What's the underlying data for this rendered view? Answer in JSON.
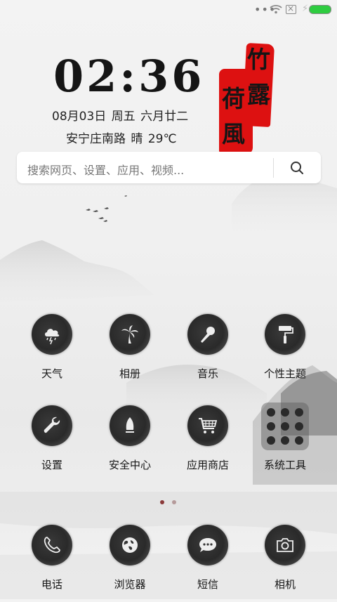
{
  "status_bar": {
    "dots": "•••",
    "colors": {
      "battery": "#2ecc40"
    }
  },
  "clock": {
    "time": "02:36",
    "date_line": "08月03日 周五 六月廿二",
    "weather_line": "安宁庄南路 晴 29℃"
  },
  "seal": {
    "chars": [
      "竹",
      "露",
      "荷",
      "風"
    ],
    "color": "#dd1111"
  },
  "search": {
    "placeholder": "搜索网页、设置、应用、视频..."
  },
  "apps": [
    {
      "label": "天气",
      "icon": "weather-icon"
    },
    {
      "label": "相册",
      "icon": "palm-tree-icon"
    },
    {
      "label": "音乐",
      "icon": "microphone-icon"
    },
    {
      "label": "个性主题",
      "icon": "paint-roller-icon"
    },
    {
      "label": "设置",
      "icon": "wrench-icon"
    },
    {
      "label": "安全中心",
      "icon": "shield-icon"
    },
    {
      "label": "应用商店",
      "icon": "cart-icon"
    },
    {
      "label": "系统工具",
      "icon": "folder-icon"
    }
  ],
  "dock": [
    {
      "label": "电话",
      "icon": "phone-icon"
    },
    {
      "label": "浏览器",
      "icon": "globe-icon"
    },
    {
      "label": "短信",
      "icon": "chat-bubble-icon"
    },
    {
      "label": "相机",
      "icon": "camera-icon"
    }
  ],
  "page_indicator": {
    "current": 1,
    "total": 2,
    "active_color": "#8b3a3a",
    "inactive_color": "#b59a9a"
  }
}
